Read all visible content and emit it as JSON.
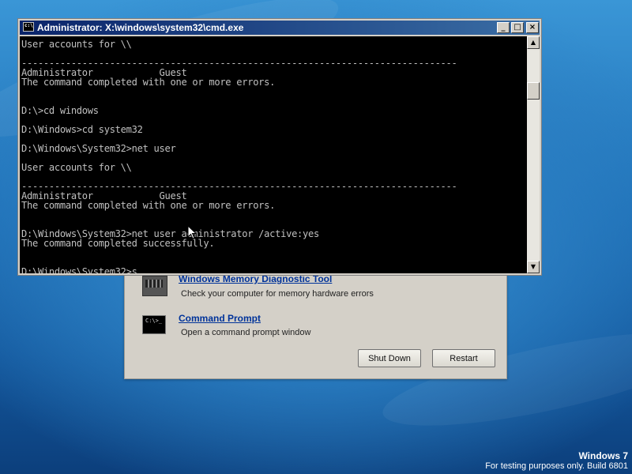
{
  "cmd_window": {
    "title": "Administrator: X:\\windows\\system32\\cmd.exe",
    "minimize": "_",
    "maximize": "□",
    "close": "×",
    "lines": [
      "User accounts for \\\\",
      "",
      "-------------------------------------------------------------------------------",
      "Administrator            Guest",
      "The command completed with one or more errors.",
      "",
      "",
      "D:\\>cd windows",
      "",
      "D:\\Windows>cd system32",
      "",
      "D:\\Windows\\System32>net user",
      "",
      "User accounts for \\\\",
      "",
      "-------------------------------------------------------------------------------",
      "Administrator            Guest",
      "The command completed with one or more errors.",
      "",
      "",
      "D:\\Windows\\System32>net user administrator /active:yes",
      "The command completed successfully.",
      "",
      "",
      "D:\\Windows\\System32>s"
    ]
  },
  "recovery": {
    "memory_tool_label": "Windows Memory Diagnostic Tool",
    "memory_tool_desc": "Check your computer for memory hardware errors",
    "cmd_label": "Command Prompt",
    "cmd_desc": "Open a command prompt window",
    "shutdown_label": "Shut Down",
    "restart_label": "Restart",
    "cmd_icon_text": "C:\\>_"
  },
  "branding": {
    "name": "Windows 7",
    "build": "For testing purposes only. Build 6801"
  }
}
